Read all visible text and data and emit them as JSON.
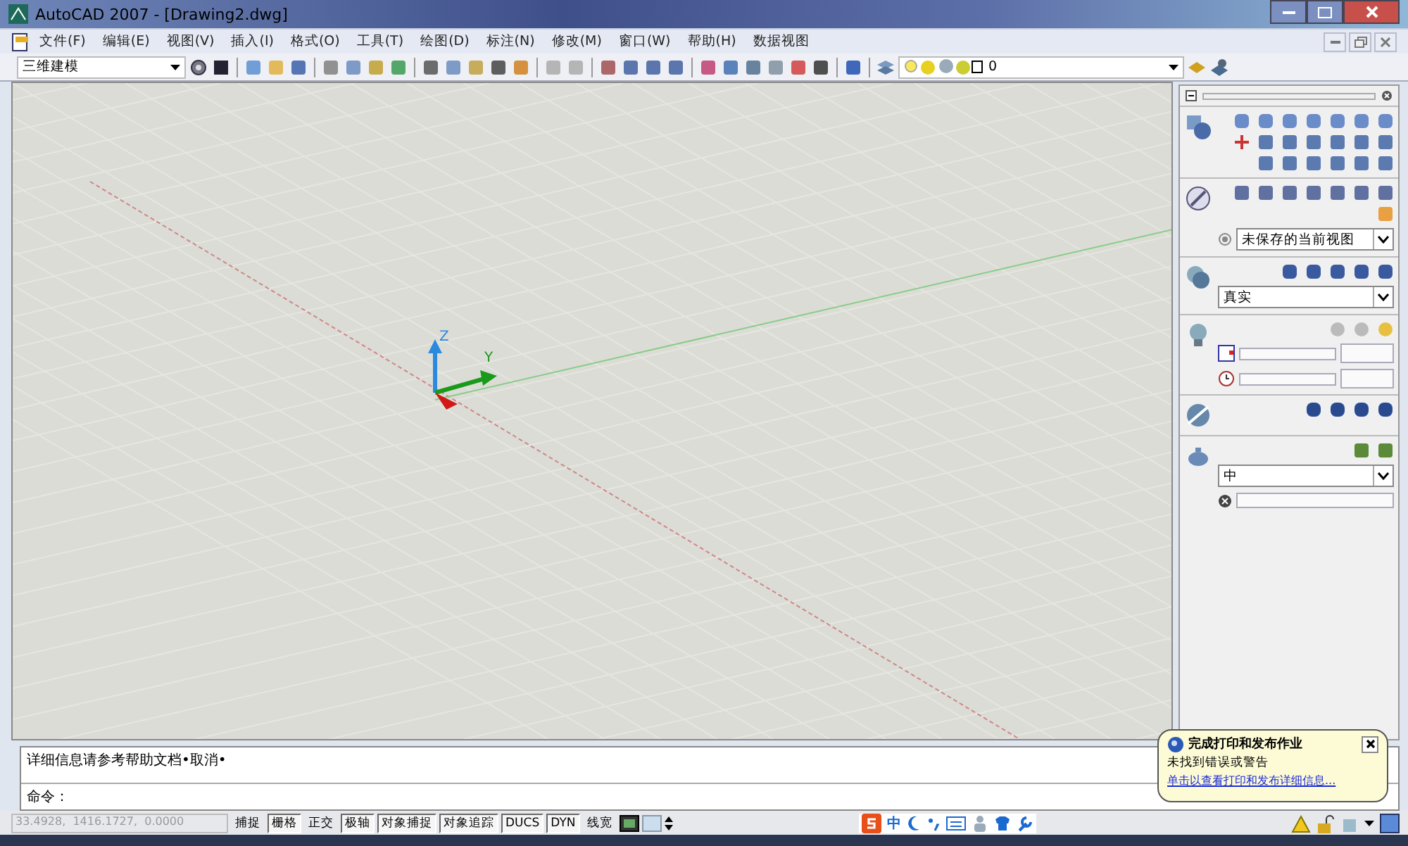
{
  "window": {
    "title": "AutoCAD 2007 - [Drawing2.dwg]"
  },
  "menu": [
    "文件(F)",
    "编辑(E)",
    "视图(V)",
    "插入(I)",
    "格式(O)",
    "工具(T)",
    "绘图(D)",
    "标注(N)",
    "修改(M)",
    "窗口(W)",
    "帮助(H)",
    "数据视图"
  ],
  "workspace": {
    "value": "三维建模"
  },
  "layer": {
    "value": "0"
  },
  "viewport": {
    "axis_labels": [
      "Z",
      "Y"
    ]
  },
  "dashboard": {
    "view": {
      "value": "未保存的当前视图"
    },
    "visual_style": {
      "value": "真实"
    },
    "material_quality": {
      "value": "中"
    }
  },
  "command_line": {
    "history": "详细信息请参考帮助文档•取消•",
    "prompt": "命令："
  },
  "status_bar": {
    "coordinates": "33.4928,  1416.1727,  0.0000",
    "toggles": [
      {
        "label": "捕捉",
        "on": false
      },
      {
        "label": "栅格",
        "on": true
      },
      {
        "label": "正交",
        "on": false
      },
      {
        "label": "极轴",
        "on": true
      },
      {
        "label": "对象捕捉",
        "on": true
      },
      {
        "label": "对象追踪",
        "on": true
      },
      {
        "label": "DUCS",
        "on": true
      },
      {
        "label": "DYN",
        "on": true
      },
      {
        "label": "线宽",
        "on": false
      }
    ]
  },
  "tray": {
    "ime": "中"
  },
  "balloon": {
    "title": "完成打印和发布作业",
    "message": "未找到错误或警告",
    "link": "单击以查看打印和发布详细信息..."
  }
}
